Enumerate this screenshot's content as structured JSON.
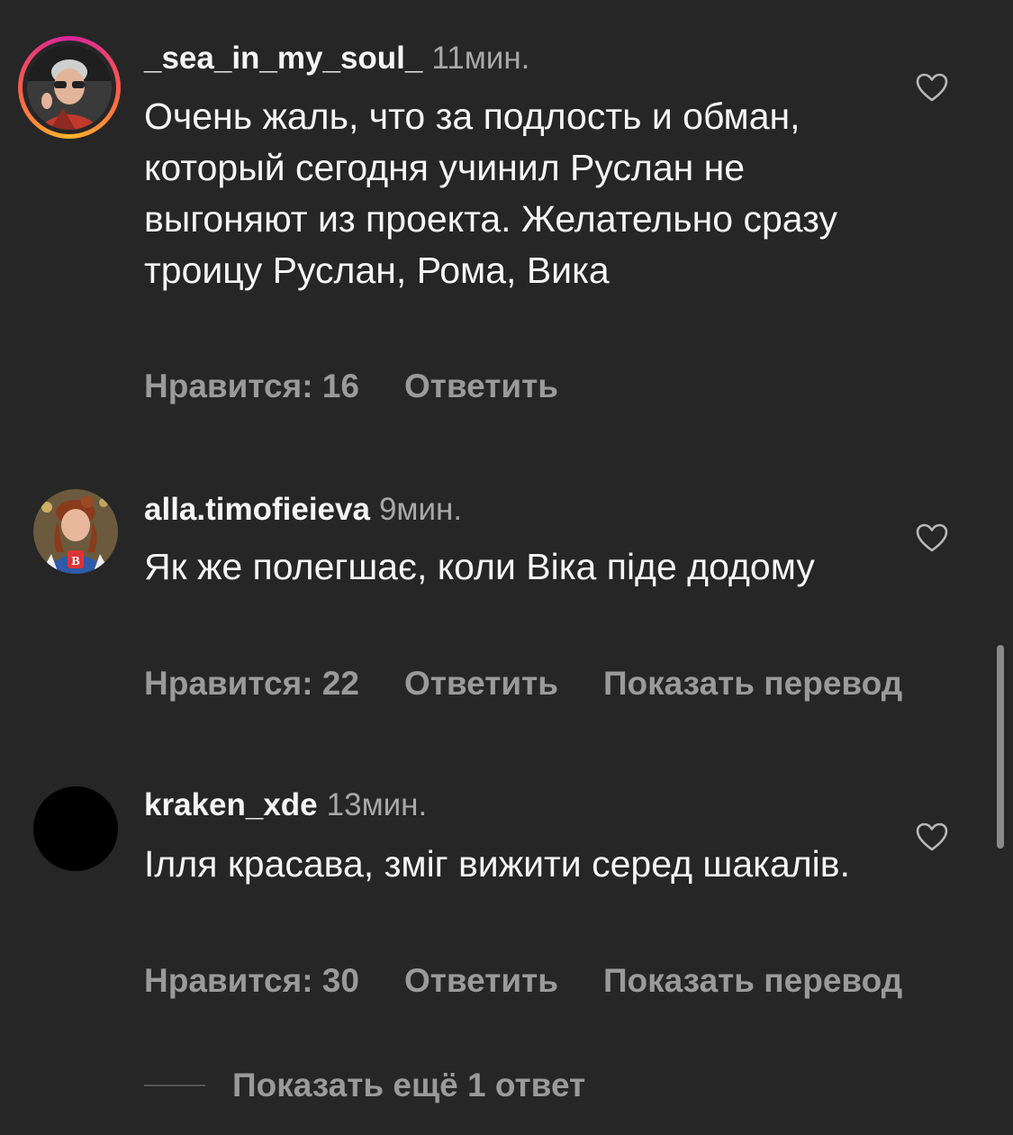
{
  "comments": [
    {
      "username": "_sea_in_my_soul_",
      "time": "11мин.",
      "text": "Очень жаль, что за подлость и обман, который сегодня учинил Руслан не выгоняют из проекта. Желательно сразу троицу Руслан, Рома, Вика",
      "likes": "Нравится: 16",
      "reply": "Ответить"
    },
    {
      "username": "alla.timofieieva",
      "time": "9мин.",
      "text": "Як же полегшає, коли Віка піде додому",
      "likes": "Нравится: 22",
      "reply": "Ответить",
      "translate": "Показать перевод"
    },
    {
      "username": "kraken_xde",
      "time": "13мин.",
      "text": "Ілля красава, зміг вижити серед шакалів.",
      "likes": "Нравится: 30",
      "reply": "Ответить",
      "translate": "Показать перевод"
    }
  ],
  "show_more": "Показать ещё 1 ответ",
  "icons": {
    "like": "heart-outline-icon",
    "avatar": "profile-photo"
  },
  "colors": {
    "background": "#262626",
    "text": "#f5f5f5",
    "muted": "#a8a8a8",
    "story_ring": "#d6249f"
  }
}
